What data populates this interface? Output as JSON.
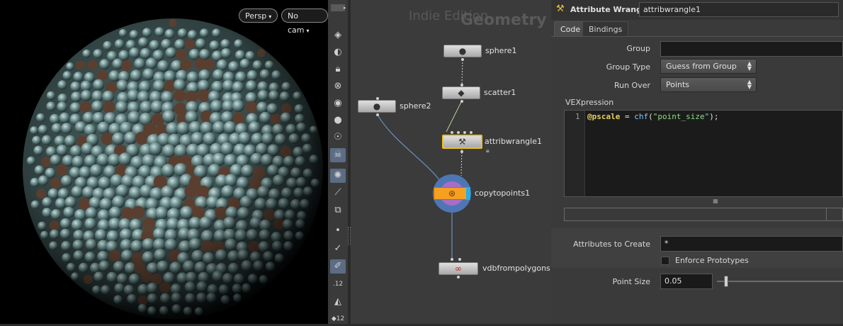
{
  "viewport": {
    "camera_mode": "Persp",
    "camera": "No cam"
  },
  "toolbar": {
    "icons": [
      "display-options-icon",
      "ghost-icon",
      "lock-icon",
      "snapping-icon",
      "visualize-icon",
      "light-icon",
      "handle-icon",
      "skull-icon",
      "shading-icon",
      "wireframe-icon",
      "background-icon",
      "point-icon",
      "brush-icon",
      "selection-icon",
      "vertex-number-icon",
      "paint-icon",
      "primitive-number-icon"
    ],
    "number_badge_1": "12",
    "number_badge_2": "12"
  },
  "network": {
    "edition_watermark": "Indie Edition",
    "context_title": "Geometry",
    "nodes": {
      "sphere1": "sphere1",
      "scatter1": "scatter1",
      "sphere2": "sphere2",
      "attribwrangle1": "attribwrangle1",
      "copytopoints1": "copytopoints1",
      "vdbfrompolygons1": "vdbfrompolygons1"
    }
  },
  "params": {
    "node_type": "Attribute Wrangle",
    "node_name": "attribwrangle1",
    "tabs": [
      "Code",
      "Bindings"
    ],
    "group_label": "Group",
    "group_value": "",
    "group_type_label": "Group Type",
    "group_type_value": "Guess from Group",
    "run_over_label": "Run Over",
    "run_over_value": "Points",
    "vex_label": "VEXpression",
    "code_line_number": "1",
    "code": {
      "attr": "@pscale",
      "op": " = ",
      "func": "chf",
      "paren_open": "(",
      "string": "\"point_size\"",
      "paren_close": ");"
    },
    "attributes_label": "Attributes to Create",
    "attributes_value": "*",
    "enforce_label": "Enforce Prototypes",
    "enforce_checked": false,
    "point_size_label": "Point Size",
    "point_size_value": "0.05"
  }
}
